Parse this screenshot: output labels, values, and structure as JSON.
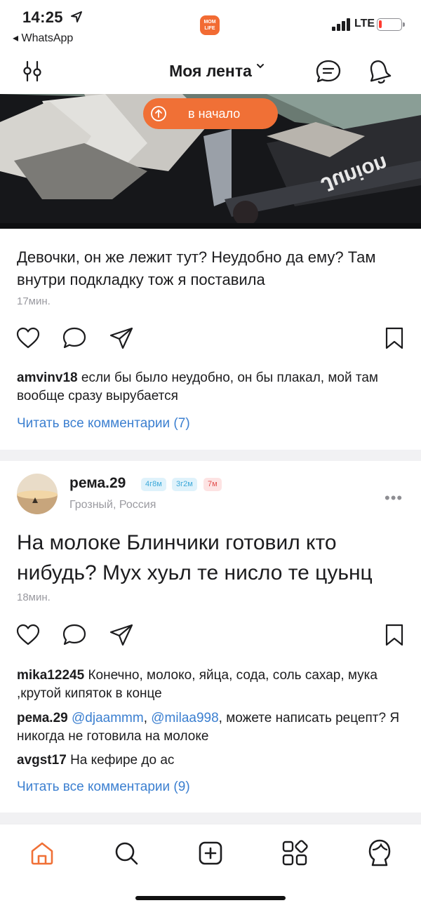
{
  "status_bar": {
    "time": "14:25",
    "back_app": "◂ WhatsApp",
    "network": "LTE",
    "app_logo": "MOM LIFE"
  },
  "header": {
    "title": "Моя лента"
  },
  "scroll_top": {
    "label": "в начало"
  },
  "post1": {
    "photo_brand": "Junion",
    "text": "Девочки, он же лежит тут? Неудобно да ему? Там внутри подкладку тож я поставила",
    "time": "17мин.",
    "comments": [
      {
        "user": "amvinv18",
        "text": "если бы было неудобно, он бы плакал, мой там вообще сразу вырубается"
      }
    ],
    "read_all": "Читать все комментарии (7)"
  },
  "post2": {
    "author": {
      "name": "рема.29",
      "badges": [
        "4г8м",
        "3г2м",
        "7м"
      ],
      "location": "Грозный, Россия"
    },
    "text": "На молоке Блинчики готовил кто нибудь? Мух хуьл те нисло те цуьнц",
    "time": "18мин.",
    "comments": [
      {
        "user": "mika12245",
        "text": "Конечно, молоко, яйца, сода, соль сахар, мука ,крутой кипяток в конце"
      },
      {
        "user": "рема.29",
        "mention1": "@djaammm",
        "sep": ", ",
        "mention2": "@milaa998",
        "text": ", можете написать рецепт? Я никогда не готовила на молоке"
      },
      {
        "user": "avgst17",
        "text": "На кефире до ас"
      }
    ],
    "read_all": "Читать все комментарии (9)"
  },
  "tabbar": {
    "items": [
      "home-icon",
      "search-icon",
      "add-post-icon",
      "services-icon",
      "profile-icon"
    ]
  },
  "colors": {
    "accent": "#f07036",
    "link": "#3b7fd0",
    "muted": "#9a9aa0"
  }
}
